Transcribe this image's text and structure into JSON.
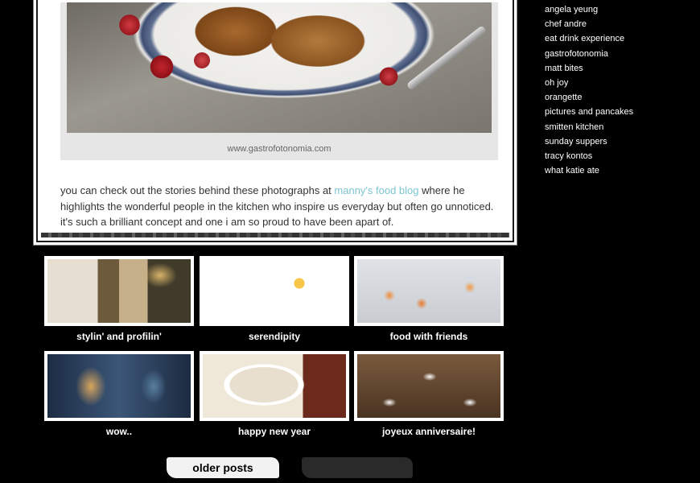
{
  "post": {
    "image_caption": "www.gastrofotonomia.com",
    "text_before_link": "you can check out the stories behind these photographs at ",
    "link_text": "manny's food blog",
    "text_after_link": " where he highlights the wonderful people in the kitchen who inspire us everyday but often go unnoticed.  it's such a brilliant concept and one i am so proud to have been apart of."
  },
  "thumbnails": [
    {
      "title": "stylin' and profilin'"
    },
    {
      "title": "serendipity"
    },
    {
      "title": "food with friends"
    },
    {
      "title": "wow.."
    },
    {
      "title": "happy new year"
    },
    {
      "title": "joyeux anniversaire!"
    }
  ],
  "pagination": {
    "older_label": "older posts"
  },
  "sidebar": {
    "links": [
      "angela yeung",
      "chef andre",
      "eat drink experience",
      "gastrofotonomia",
      "matt bites",
      "oh joy",
      "orangette",
      "pictures and pancakes",
      "smitten kitchen",
      "sunday suppers",
      "tracy kontos",
      "what katie ate"
    ]
  }
}
